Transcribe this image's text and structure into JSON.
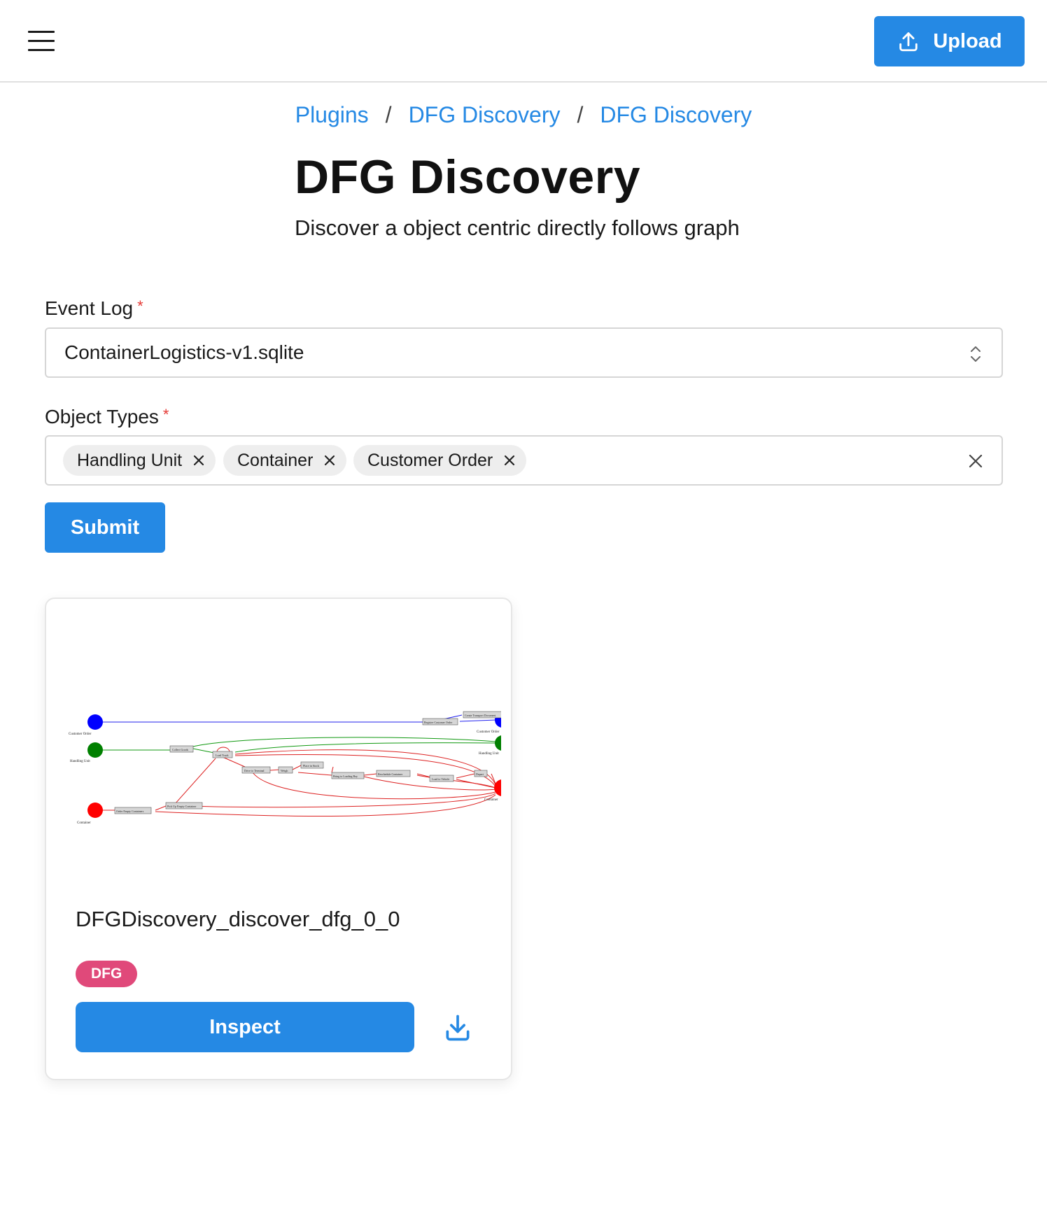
{
  "header": {
    "menu_icon": "hamburger-menu-icon",
    "upload_label": "Upload",
    "upload_icon": "upload-icon"
  },
  "breadcrumb": [
    "Plugins",
    "DFG Discovery",
    "DFG Discovery"
  ],
  "page": {
    "title": "DFG Discovery",
    "subtitle": "Discover a object centric directly follows graph"
  },
  "form": {
    "event_log": {
      "label": "Event Log",
      "required_mark": "*",
      "value": "ContainerLogistics-v1.sqlite"
    },
    "object_types": {
      "label": "Object Types",
      "required_mark": "*",
      "selected": [
        "Handling Unit",
        "Container",
        "Customer Order"
      ]
    },
    "submit_label": "Submit"
  },
  "result_card": {
    "title": "DFGDiscovery_discover_dfg_0_0",
    "badge": "DFG",
    "inspect_label": "Inspect",
    "download_icon": "download-icon",
    "graph": {
      "source_labels": [
        "Customer Order",
        "Handling Unit",
        "Container"
      ],
      "sink_labels": [
        "Customer Order",
        "Handling Unit",
        "Container"
      ],
      "activities": [
        "Register Customer Order",
        "Create Transport Document",
        "Collect Goods",
        "Load Truck",
        "Drive to Terminal",
        "Weigh",
        "Place in Stock",
        "Bring to Loading Bay",
        "Reschedule Container",
        "Load to Vehicle",
        "Depart",
        "Order Empty Containers",
        "Pick Up Empty Container"
      ]
    }
  },
  "colors": {
    "primary": "#2589e4",
    "badge": "#e0497a",
    "required": "#e53935",
    "customer_order": "#0000ff",
    "handling_unit": "#008000",
    "container": "#ff0000"
  }
}
